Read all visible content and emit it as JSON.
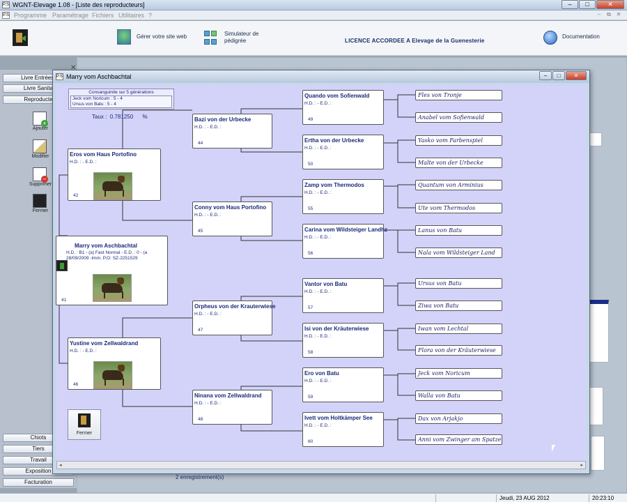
{
  "app": {
    "title": "WGNT-Elevage 1.08 - [Liste des reproducteurs]",
    "icon_text": "P.S",
    "menu": [
      "Programme",
      "Paramétrage",
      "Fichiers",
      "Utilitaires",
      "?"
    ],
    "toolbar": {
      "site_label": "Gérer votre site web",
      "simulator_label_1": "Simulateur de",
      "simulator_label_2": "pédigrée",
      "licence": "LICENCE ACCORDEE A   Elevage de la Guenesterie",
      "doc_label": "Documentation"
    },
    "sidebar": {
      "top_buttons": [
        "Livre Entrées-",
        "Livre Sanita",
        "Reproducte"
      ],
      "tools": [
        "Ajouter",
        "Modifier",
        "Supprimer",
        "Fermer"
      ],
      "bottom_buttons": [
        "Chiots",
        "Tiers",
        "Travail",
        "Exposition",
        "Facturation"
      ]
    },
    "records": "2     enregistrement(s)",
    "status": {
      "date": "Jeudi, 23 AUG 2012",
      "time": "20:23:10"
    }
  },
  "dialog": {
    "title": "Marry vom Aschbachtal",
    "consanguinity": {
      "title": "Consanguinite sur 5 générations",
      "entries": [
        "Jeck vom Noricum : 5 - 4",
        "Ursus von Batu : 5 - 4"
      ],
      "taux_label": "Taux :",
      "taux_value": "0.781250",
      "taux_unit": "%"
    },
    "subject": {
      "name": "Marry vom Aschbachtal",
      "hd": "H.D. : B1 - (a) Fast Normal - E.D. : 0 - (a 28/09/2009 -Imm. P.O: SZ-2251529",
      "num": "41"
    },
    "gen1": [
      {
        "name": "Eros vom Haus Portofino",
        "hd": "H.D. :   - E.D. :",
        "num": "42"
      },
      {
        "name": "Yustine vom Zellwaldrand",
        "hd": "H.D. :   - E.D. :",
        "num": "46"
      }
    ],
    "gen2": [
      {
        "name": "Bazi von der Urbecke",
        "hd": "H.D. :   - E.D. :",
        "num": "44"
      },
      {
        "name": "Conny vom Haus Portofino",
        "hd": "H.D. :   - E.D. :",
        "num": "45"
      },
      {
        "name": "Orpheus von der Krauterwiese",
        "hd": "H.D. :   - E.D. :",
        "num": "47"
      },
      {
        "name": "Ninana vom Zellwaldrand",
        "hd": "H.D. :   - E.D. :",
        "num": "48"
      }
    ],
    "gen3": [
      {
        "name": "Quando vom Sofienwald",
        "hd": "H.D. :   - E.D. :",
        "num": "49"
      },
      {
        "name": "Ertha von der Urbecke",
        "hd": "H.D. :   - E.D. :",
        "num": "50"
      },
      {
        "name": "Zamp vom Thermodos",
        "hd": "H.D. :   - E.D. :",
        "num": "55"
      },
      {
        "name": "Carina vom Wildsteiger Landhz",
        "hd": "H.D. :   - E.D. :",
        "num": "56"
      },
      {
        "name": "Vantor von Batu",
        "hd": "H.D. :   - E.D. :",
        "num": "57"
      },
      {
        "name": "Isi von der Kräuterwiese",
        "hd": "H.D. :   - E.D. :",
        "num": "58"
      },
      {
        "name": "Ero von Batu",
        "hd": "H.D. :   - E.D. :",
        "num": "59"
      },
      {
        "name": "Ivett vom Holtkämper See",
        "hd": "H.D. :   - E.D. :",
        "num": "60"
      }
    ],
    "gen4": [
      "Fles von Tronje",
      "Anabel vom Sofienwald",
      "Yasko vom Farbenspiel",
      "Malte von der Urbecke",
      "Quantum von Arminius",
      "Ute vom Thermodos",
      "Lanus von Batu",
      "Nala vom Wildsteiger Land",
      "Ursus von Batu",
      "Ziwa von Batu",
      "Iwan vom Lechtal",
      "Flora von der Kräuterwiese",
      "Jeck vom Noricum",
      "Walla von Batu",
      "Dax von Arjakjo",
      "Anni vom Zwinger am Spatzen"
    ],
    "close_label": "Fermer"
  }
}
